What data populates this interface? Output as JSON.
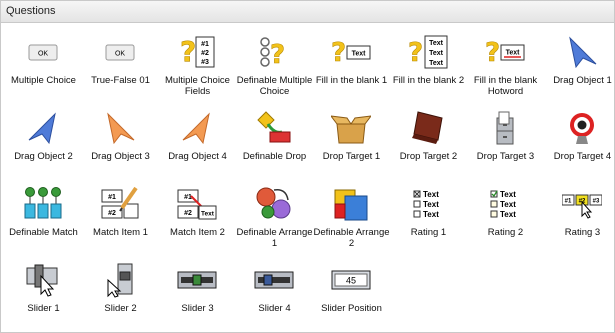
{
  "panel": {
    "title": "Questions"
  },
  "items": [
    {
      "label": "Multiple Choice",
      "icon": "ok-button-icon"
    },
    {
      "label": "True-False 01",
      "icon": "ok-button-icon"
    },
    {
      "label": "Multiple Choice Fields",
      "icon": "question-numbered-fields-icon"
    },
    {
      "label": "Definable Multiple Choice",
      "icon": "question-circles-icon"
    },
    {
      "label": "Fill in the blank 1",
      "icon": "question-text-field-icon"
    },
    {
      "label": "Fill in the blank 2",
      "icon": "question-text-stack-icon"
    },
    {
      "label": "Fill in the blank Hotword",
      "icon": "question-hotword-icon"
    },
    {
      "label": "Drag Object 1",
      "icon": "blue-arrow-icon"
    },
    {
      "label": "Drag Object 2",
      "icon": "blue-arrow-left-icon"
    },
    {
      "label": "Drag Object 3",
      "icon": "orange-arrow-icon"
    },
    {
      "label": "Drag Object 4",
      "icon": "orange-arrow-left-icon"
    },
    {
      "label": "Definable Drop",
      "icon": "drop-diamond-icon"
    },
    {
      "label": "Drop Target 1",
      "icon": "open-box-icon"
    },
    {
      "label": "Drop Target 2",
      "icon": "briefcase-icon"
    },
    {
      "label": "Drop Target 3",
      "icon": "file-cabinet-icon"
    },
    {
      "label": "Drop Target 4",
      "icon": "target-icon"
    },
    {
      "label": "Definable Match",
      "icon": "match-buckets-icon"
    },
    {
      "label": "Match Item 1",
      "icon": "match-pencil-icon"
    },
    {
      "label": "Match Item 2",
      "icon": "match-text-icon"
    },
    {
      "label": "Definable Arrange 1",
      "icon": "arrange-circles-icon"
    },
    {
      "label": "Definable Arrange 2",
      "icon": "arrange-squares-icon"
    },
    {
      "label": "Rating 1",
      "icon": "rating-list-icon"
    },
    {
      "label": "Rating 2",
      "icon": "rating-checked-list-icon"
    },
    {
      "label": "Rating 3",
      "icon": "rating-numbers-icon"
    },
    {
      "label": "Slider 1",
      "icon": "slider-cursor-icon"
    },
    {
      "label": "Slider 2",
      "icon": "slider-handle-icon"
    },
    {
      "label": "Slider 3",
      "icon": "slider-bar-icon"
    },
    {
      "label": "Slider 4",
      "icon": "slider-bar-alt-icon"
    },
    {
      "label": "Slider Position",
      "icon": "slider-position-icon"
    }
  ],
  "icon_text": {
    "ok": "OK",
    "num1": "#1",
    "num2": "#2",
    "num3": "#3",
    "text": "Text",
    "position_value": "45"
  },
  "colors": {
    "accent_yellow": "#f2c21a",
    "accent_blue": "#4f7bd8",
    "accent_orange": "#f39a52",
    "header_bg": "#ececec"
  }
}
